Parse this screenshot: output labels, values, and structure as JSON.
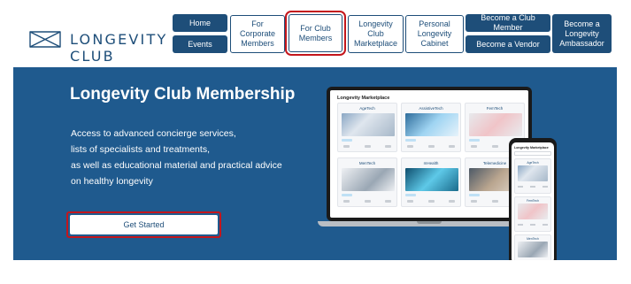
{
  "brand": {
    "name": "LONGEVITY CLUB",
    "color": "#1e4e79"
  },
  "nav": {
    "home": "Home",
    "events": "Events",
    "corporate": "For Corporate Members",
    "club_members": "For Club Members",
    "marketplace": "Longevity Club Marketplace",
    "cabinet": "Personal Longevity Cabinet",
    "become_member": "Become a Club Member",
    "become_vendor": "Become a Vendor",
    "ambassador": "Become a Longevity Ambassador"
  },
  "hero": {
    "title": "Longevity Club Membership",
    "description_lines": [
      "Access to advanced concierge services,",
      "lists of specialists and treatments,",
      "as well as educational material and practical advice",
      "on healthy longevity"
    ],
    "cta": "Get Started",
    "background": "#1f5a8e"
  },
  "laptop_screen": {
    "title": "Longevity Marketplace",
    "cards": [
      "AgeTech",
      "AssistiveTech",
      "FemTech",
      "MenTech",
      "mHealth",
      "Telemedicine"
    ]
  },
  "phone_screen": {
    "title": "Longevity Marketplace",
    "cards": [
      "AgeTech",
      "FemTech",
      "MenTech"
    ]
  },
  "colors": {
    "accent": "#1e4e79",
    "highlight": "#c4161c"
  }
}
